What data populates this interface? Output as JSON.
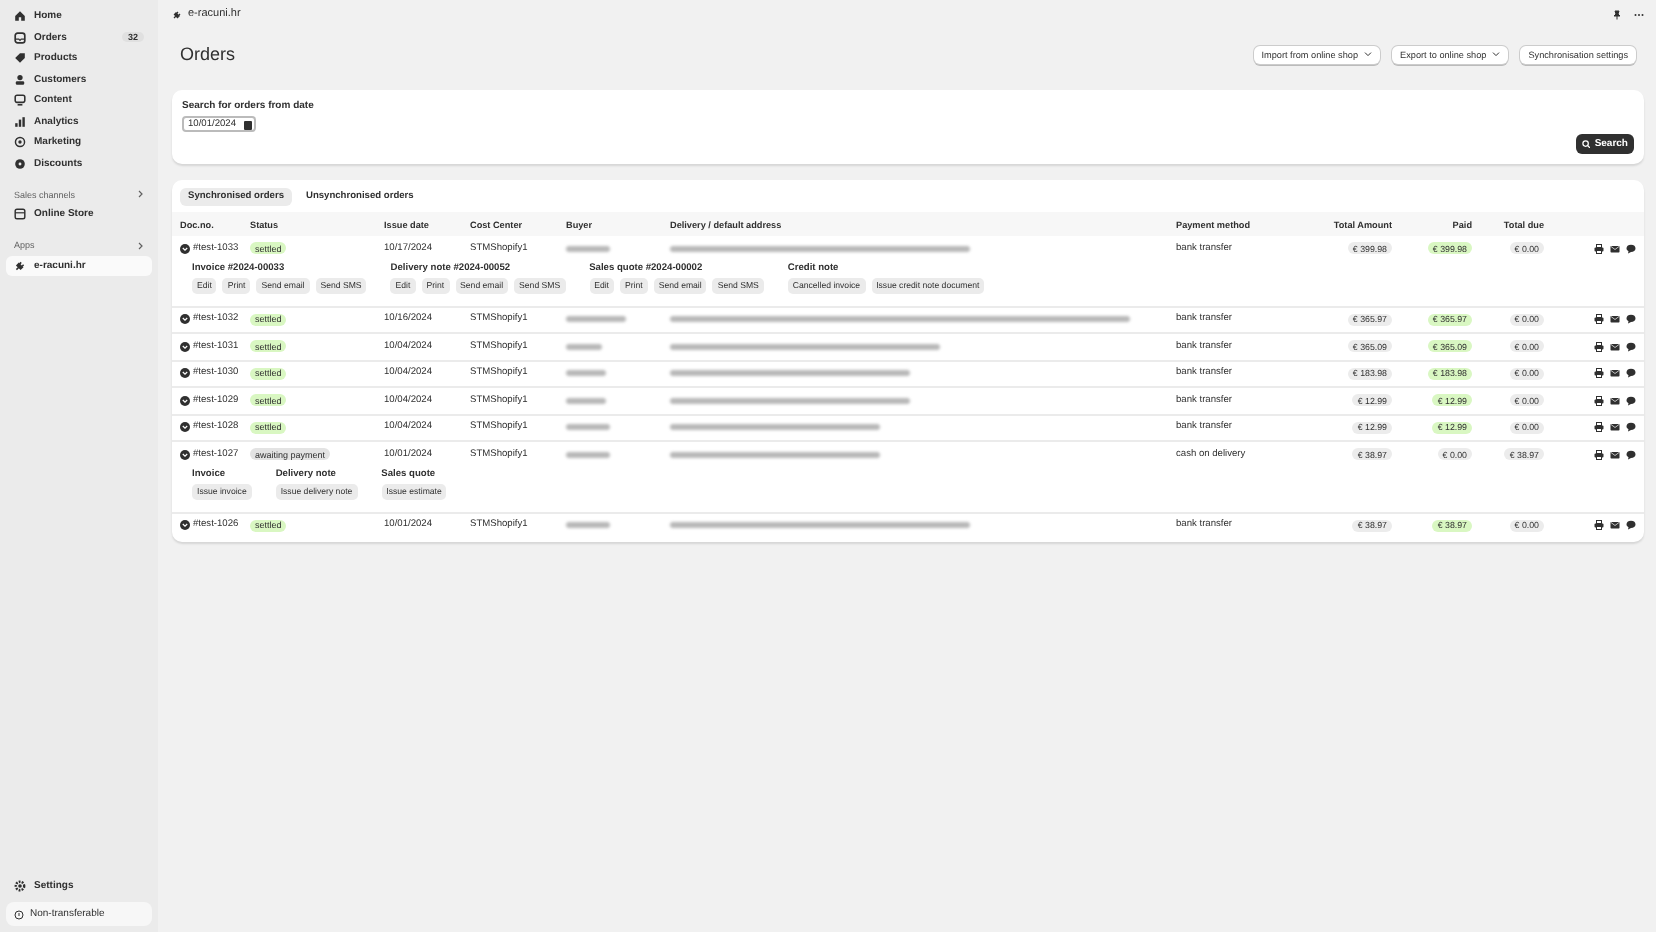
{
  "sidebar": {
    "items": [
      {
        "label": "Home",
        "selected": false
      },
      {
        "label": "Orders",
        "badge": "32",
        "selected": false
      },
      {
        "label": "Products",
        "selected": false
      },
      {
        "label": "Customers",
        "selected": false
      },
      {
        "label": "Content",
        "selected": false
      },
      {
        "label": "Analytics",
        "selected": false
      },
      {
        "label": "Marketing",
        "selected": false
      },
      {
        "label": "Discounts",
        "selected": false
      }
    ],
    "sales_channels": {
      "label": "Sales channels",
      "items": [
        {
          "label": "Online Store",
          "selected": false
        }
      ]
    },
    "apps": {
      "label": "Apps",
      "items": [
        {
          "label": "e-racuni.hr",
          "selected": true
        }
      ]
    },
    "settings": "Settings",
    "footer": "Non-transferable"
  },
  "topbar": {
    "app_name": "e-racuni.hr"
  },
  "page": {
    "title": "Orders",
    "actions": [
      {
        "label": "Import from online shop",
        "dropdown": true
      },
      {
        "label": "Export to online shop",
        "dropdown": true
      },
      {
        "label": "Synchronisation settings",
        "dropdown": false
      }
    ]
  },
  "search": {
    "label": "Search for orders from date",
    "date": "10/01/2024",
    "button": "Search"
  },
  "tabs": [
    {
      "label": "Synchronised orders",
      "selected": true
    },
    {
      "label": "Unsynchronised orders",
      "selected": false
    }
  ],
  "table": {
    "columns": [
      "Doc.no.",
      "Status",
      "Issue date",
      "Cost Center",
      "Buyer",
      "Delivery / default address",
      "Payment method",
      "Total Amount",
      "Paid",
      "Total due"
    ],
    "rows": [
      {
        "doc": "#test-1033",
        "status": "settled",
        "kind": "settled",
        "date": "10/17/2024",
        "cost_center": "STMShopify1",
        "payment": "bank transfer",
        "total": "€ 399.98",
        "paid": "€ 399.98",
        "paid_highlight": true,
        "due": "€ 0.00",
        "details": [
          {
            "title": "Invoice #2024-00033",
            "buttons": [
              "Edit",
              "Print",
              "Send email",
              "Send SMS"
            ]
          },
          {
            "title": "Delivery note #2024-00052",
            "buttons": [
              "Edit",
              "Print",
              "Send email",
              "Send SMS"
            ]
          },
          {
            "title": "Sales quote #2024-00002",
            "buttons": [
              "Edit",
              "Print",
              "Send email",
              "Send SMS"
            ]
          },
          {
            "title": "Credit note",
            "buttons": [
              "Cancelled invoice",
              "Issue credit note document"
            ]
          }
        ]
      },
      {
        "doc": "#test-1032",
        "status": "settled",
        "kind": "settled",
        "date": "10/16/2024",
        "cost_center": "STMShopify1",
        "payment": "bank transfer",
        "total": "€ 365.97",
        "paid": "€ 365.97",
        "paid_highlight": true,
        "due": "€ 0.00"
      },
      {
        "doc": "#test-1031",
        "status": "settled",
        "kind": "settled",
        "date": "10/04/2024",
        "cost_center": "STMShopify1",
        "payment": "bank transfer",
        "total": "€ 365.09",
        "paid": "€ 365.09",
        "paid_highlight": true,
        "due": "€ 0.00"
      },
      {
        "doc": "#test-1030",
        "status": "settled",
        "kind": "settled",
        "date": "10/04/2024",
        "cost_center": "STMShopify1",
        "payment": "bank transfer",
        "total": "€ 183.98",
        "paid": "€ 183.98",
        "paid_highlight": true,
        "due": "€ 0.00"
      },
      {
        "doc": "#test-1029",
        "status": "settled",
        "kind": "settled",
        "date": "10/04/2024",
        "cost_center": "STMShopify1",
        "payment": "bank transfer",
        "total": "€ 12.99",
        "paid": "€ 12.99",
        "paid_highlight": true,
        "due": "€ 0.00"
      },
      {
        "doc": "#test-1028",
        "status": "settled",
        "kind": "settled",
        "date": "10/04/2024",
        "cost_center": "STMShopify1",
        "payment": "bank transfer",
        "total": "€ 12.99",
        "paid": "€ 12.99",
        "paid_highlight": true,
        "due": "€ 0.00"
      },
      {
        "doc": "#test-1027",
        "status": "awaiting payment",
        "kind": "awaiting",
        "date": "10/01/2024",
        "cost_center": "STMShopify1",
        "payment": "cash on delivery",
        "total": "€ 38.97",
        "paid": "€ 0.00",
        "paid_highlight": false,
        "due": "€ 38.97",
        "details": [
          {
            "title": "Invoice",
            "buttons": [
              "Issue invoice"
            ]
          },
          {
            "title": "Delivery note",
            "buttons": [
              "Issue delivery note"
            ]
          },
          {
            "title": "Sales quote",
            "buttons": [
              "Issue estimate"
            ]
          }
        ]
      },
      {
        "doc": "#test-1026",
        "status": "settled",
        "kind": "settled",
        "date": "10/01/2024",
        "cost_center": "STMShopify1",
        "payment": "bank transfer",
        "total": "€ 38.97",
        "paid": "€ 38.97",
        "paid_highlight": true,
        "due": "€ 0.00"
      }
    ]
  }
}
